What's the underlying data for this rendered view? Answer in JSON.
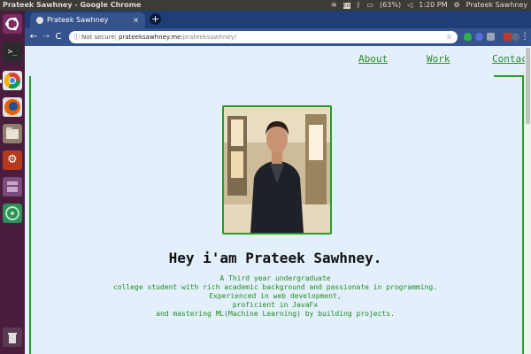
{
  "system_bar": {
    "window_title": "Prateek Sawhney - Google Chrome",
    "battery": "(63%)",
    "time": "1:20 PM",
    "user": "Prateek Sawhney",
    "keyboard_badge": "En"
  },
  "launcher": {
    "apps": [
      "ubuntu-dash",
      "terminal",
      "chrome",
      "firefox",
      "files",
      "settings",
      "software",
      "ubuntu-software",
      "trash"
    ]
  },
  "browser": {
    "tab_title": "Prateek Sawhney",
    "tab_close": "×",
    "new_tab": "+",
    "back": "←",
    "forward": "→",
    "reload": "C",
    "security_label": "Not secure",
    "url_host": "prateeksawhney.me",
    "url_path": "/prateeksawhney/",
    "star": "☆",
    "menu": "⋮"
  },
  "page": {
    "nav": {
      "about": "About",
      "work": "Work",
      "contact": "Contact"
    },
    "heading": "Hey i'am Prateek Sawhney.",
    "bio_lines": [
      "A Third year undergraduate",
      "college student with rich academic background and passionate in programming.",
      "Experienced in web development,",
      "proficient in JavaFx",
      "and mastering ML(Machine Learning) by building projects."
    ]
  },
  "colors": {
    "accent_green": "#2a8a2a",
    "chrome_blue": "#35548d",
    "launcher_purple": "#4a1d3d",
    "page_bg": "#e3effb"
  }
}
